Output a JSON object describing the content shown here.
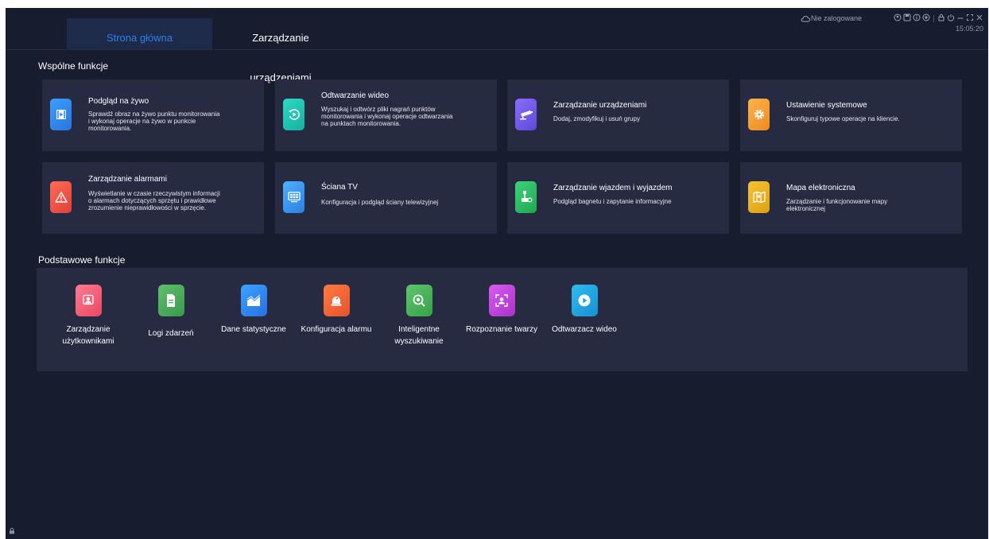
{
  "header": {
    "tabs": [
      {
        "label": "Strona główna",
        "active": true
      },
      {
        "label": "Zarządzanie urządzeniami",
        "active": false
      }
    ],
    "login_status": "Nie zalogowane",
    "time": "15:05:20",
    "icons": [
      "cloud-icon",
      "user-icon",
      "save-icon",
      "info-icon",
      "settings-icon",
      "lock-icon",
      "power-icon",
      "minimize-icon",
      "fullscreen-icon",
      "close-icon"
    ]
  },
  "common": {
    "title": "Wspólne funkcje",
    "cards": [
      {
        "title": "Podgląd na żywo",
        "desc": "Sprawdź obraz na żywo punktu monitorowania i wykonaj operacje na żywo w punkcie monitorowania.",
        "icon": "live-view-icon",
        "color": "#2f8ff5"
      },
      {
        "title": "Odtwarzanie wideo",
        "desc": "Wyszukaj i odtwórz pliki nagrań punktów monitorowania i wykonaj operacje odtwarzania na punktach monitorowania.",
        "icon": "playback-icon",
        "color": "#1ec6b4"
      },
      {
        "title": "Zarządzanie urządzeniami",
        "desc": "Dodaj, zmodyfikuj i usuń grupy",
        "icon": "camera-icon",
        "color": "#7a5cf0"
      },
      {
        "title": "Ustawienie systemowe",
        "desc": "Skonfiguruj typowe operacje na kliencie.",
        "icon": "gear-icon",
        "color": "#f3a13a"
      },
      {
        "title": "Zarządzanie alarmami",
        "desc": "Wyświetlanie w czasie rzeczywistym informacji o alarmach dotyczących sprzętu i prawidłowe zrozumienie nieprawidłowości w sprzęcie.",
        "icon": "alarm-icon",
        "color": "#f0584a"
      },
      {
        "title": "Ściana TV",
        "desc": "Konfiguracja i podgląd ściany telewizyjnej",
        "icon": "tv-wall-icon",
        "color": "#3a9bf0"
      },
      {
        "title": "Zarządzanie wjazdem i wyjazdem",
        "desc": "Podgląd bagnetu i zapytanie informacyjne",
        "icon": "barrier-icon",
        "color": "#27c060"
      },
      {
        "title": "Mapa elektroniczna",
        "desc": "Zarządzanie i funkcjonowanie mapy elektronicznej",
        "icon": "map-icon",
        "color": "#e8b420"
      }
    ]
  },
  "basic": {
    "title": "Podstawowe funkcje",
    "tiles": [
      {
        "label": "Zarządzanie użytkownikami",
        "icon": "users-icon",
        "color": "#f0607a"
      },
      {
        "label": "Logi zdarzeń",
        "icon": "log-icon",
        "color": "#4caa5c"
      },
      {
        "label": "Dane statystyczne",
        "icon": "statistics-icon",
        "color": "#2e8ef0"
      },
      {
        "label": "Konfiguracja alarmu",
        "icon": "alarm-config-icon",
        "color": "#f0643a"
      },
      {
        "label": "Inteligentne wyszukiwanie",
        "icon": "smart-search-icon",
        "color": "#46b65a"
      },
      {
        "label": "Rozpoznanie twarzy",
        "icon": "face-recognition-icon",
        "color": "#c242d8"
      },
      {
        "label": "Odtwarzacz wideo",
        "icon": "video-player-icon",
        "color": "#1ca8e0"
      }
    ]
  }
}
